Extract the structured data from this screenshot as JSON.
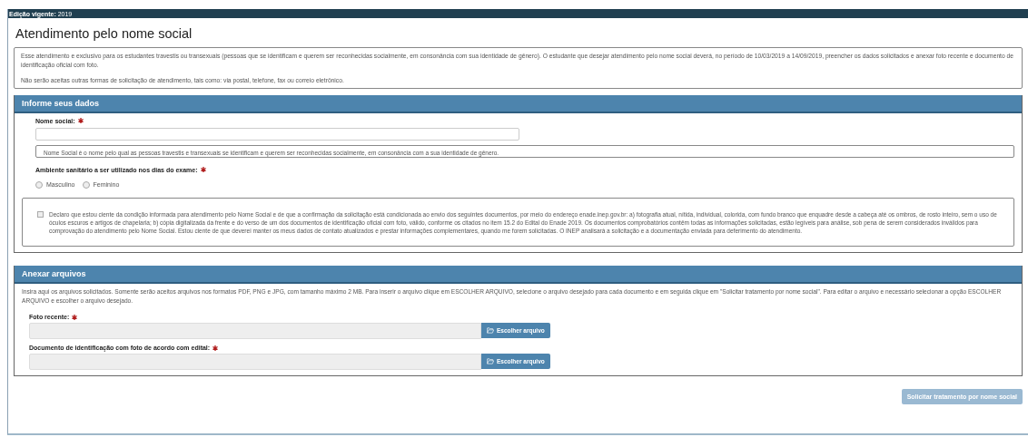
{
  "top_bar": {
    "label": "Edição vigente:",
    "value": "2019"
  },
  "title": "Atendimento pelo nome social",
  "intro": [
    "Esse atendimento e exclusivo para os estudantes travestis ou transexuais (pessoas que se identificam e querem ser reconhecidas socialmente, em consonância com sua identidade de gênero). O estudante que desejar atendimento pelo nome social deverá, no período de 10/03/2019 a 14/09/2019, preencher os dados solicitados e anexar foto recente e documento de identificação oficial com foto.",
    "Não serão aceitas outras formas de solicitação de atendimento, tais como: via postal, telefone, fax ou correio eletrônico."
  ],
  "data_section": {
    "title": "Informe seus dados",
    "name_field": {
      "label": "Nome social:",
      "required": true
    },
    "name_help": "Nome Social é o nome pelo qual as pessoas travestis e transexuais se identificam e querem ser reconhecidas socialmente, em consonância com a sua identidade de gênero.",
    "restroom": {
      "label": "Ambiente sanitário a ser utilizado nos dias do exame:",
      "required": true,
      "options": [
        {
          "label": "Masculino",
          "selected": false
        },
        {
          "label": "Feminino",
          "selected": false
        }
      ]
    },
    "declaration": {
      "checked": false,
      "text": "Declaro que estou ciente da condição informada para atendimento pelo Nome Social e de que a confirmação da solicitação está condicionada ao envio dos seguintes documentos, por meio do endereço enade.inep.gov.br: a) fotografia atual, nítida, individual, colorida, com fundo branco que enquadre desde a cabeça até os ombros, de rosto inteiro, sem o uso de óculos escuros e artigos de chapelaria; b) cópia digitalizada da frente e do verso de um dos documentos de identificação oficial com foto, válido, conforme os citados no item 15.2 do Edital do Enade 2019. Os documentos comprobatórios contêm todas as informações solicitadas, estão legíveis para análise, sob pena de serem considerados inválidos para comprovação do atendimento pelo Nome Social. Estou ciente de que deverei manter os meus dados de contato atualizados e prestar informações complementares, quando me forem solicitadas. O INEP analisará a solicitação e a documentação enviada para deferimento do atendimento."
    }
  },
  "files_section": {
    "title": "Anexar arquivos",
    "instructions": "Insira aqui os arquivos solicitados. Somente serão aceitos arquivos nos formatos PDF, PNG e JPG, com tamanho máximo 2 MB. Para inserir o arquivo clique em ESCOLHER ARQUIVO, selecione o arquivo desejado para cada documento e em seguida clique em \"Solicitar tratamento por nome social\". Para editar o arquivo e necessário selecionar a opção ESCOLHER ARQUIVO e escolher o arquivo desejado.",
    "files": [
      {
        "label": "Foto recente:",
        "required": true,
        "button": "Escolher arquivo"
      },
      {
        "label": "Documento de identificação com foto de acordo com edital:",
        "required": true,
        "button": "Escolher arquivo"
      }
    ]
  },
  "submit": {
    "label": "Solicitar tratamento por nome social",
    "disabled": true
  }
}
